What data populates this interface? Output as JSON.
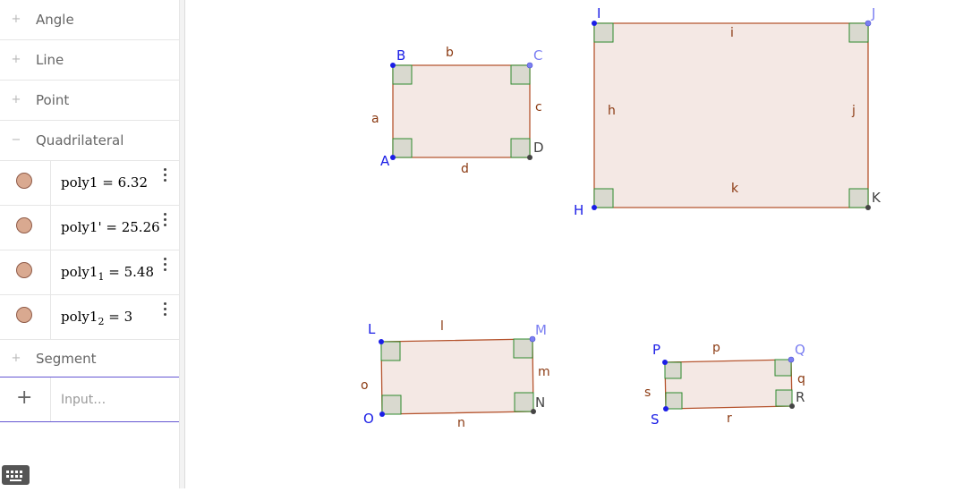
{
  "algebra": {
    "groups": [
      {
        "label": "Angle",
        "icon": "plus-icon"
      },
      {
        "label": "Line",
        "icon": "plus-icon"
      },
      {
        "label": "Point",
        "icon": "plus-icon"
      },
      {
        "label": "Quadrilateral",
        "icon": "minus-icon"
      }
    ],
    "items": [
      {
        "name": "poly1",
        "sub": "",
        "value": "6.32"
      },
      {
        "name": "poly1'",
        "sub": "",
        "value": "25.26"
      },
      {
        "name": "poly1",
        "sub": "1",
        "value": "5.48"
      },
      {
        "name": "poly1",
        "sub": "2",
        "value": "3"
      }
    ],
    "segment_group": {
      "label": "Segment",
      "icon": "plus-icon"
    },
    "input": {
      "placeholder": "Input…"
    },
    "equals": "="
  },
  "colors": {
    "fill": "#f4e8e4",
    "edge": "#b5542e",
    "point_free": "#1b1ee6",
    "point_dependent": "#7b7ff2",
    "point_fixed": "#444444",
    "angle_marker": "#2e8a2e",
    "label_segment": "#8b3a12"
  },
  "canvas": {
    "points": {
      "A": "A",
      "B": "B",
      "C": "C",
      "D": "D",
      "H": "H",
      "I": "I",
      "J": "J",
      "K": "K",
      "L": "L",
      "M": "M",
      "N": "N",
      "O": "O",
      "P": "P",
      "Q": "Q",
      "R": "R",
      "S": "S"
    },
    "segments": {
      "a": "a",
      "b": "b",
      "c": "c",
      "d": "d",
      "h": "h",
      "i": "i",
      "j": "j",
      "k": "k",
      "l": "l",
      "m": "m",
      "n": "n",
      "o": "o",
      "p": "p",
      "q": "q",
      "r": "r",
      "s": "s"
    }
  }
}
